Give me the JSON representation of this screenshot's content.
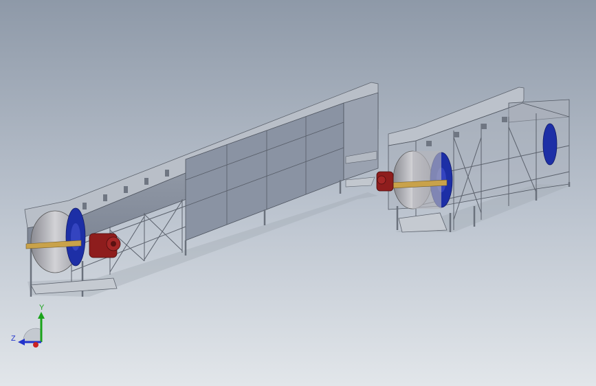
{
  "viewport": {
    "background_top": "#8e99a8",
    "background_bottom": "#e2e6ea"
  },
  "colors": {
    "frame": "#9aa0a8",
    "panel": "#8d95a4",
    "drum": "#b7b7bd",
    "blue_disc": "#1d2fa6",
    "motor": "#8e1d1d",
    "belt_accent": "#c9a24a"
  },
  "triad": {
    "y_label": "Y",
    "z_label": "Z",
    "y_color": "#1aa31a",
    "z_color": "#2233cc",
    "x_color": "#cc2222"
  }
}
